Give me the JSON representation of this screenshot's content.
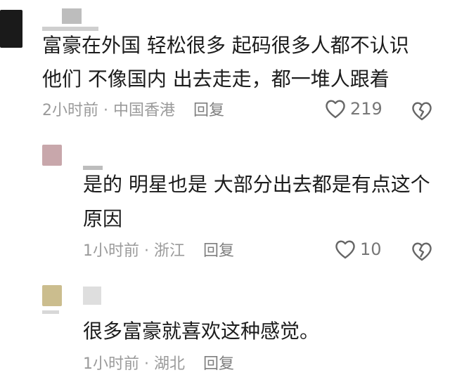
{
  "comments": [
    {
      "text_lines": [
        "富豪在外国 轻松很多 起码很多人都不认识",
        "他们 不像国内 出去走走，都一堆人跟着"
      ],
      "time": "2小时前",
      "location": "中国香港",
      "reply_label": "回复",
      "likes": "219",
      "avatar_color": "#1a1a1a"
    },
    {
      "text_lines": [
        "是的 明星也是 大部分出去都是有点这个",
        "原因"
      ],
      "time": "1小时前",
      "location": "浙江",
      "reply_label": "回复",
      "likes": "10",
      "avatar_color": "#c8a7ab"
    },
    {
      "text_lines": [
        "很多富豪就喜欢这种感觉。"
      ],
      "time": "1小时前",
      "location": "湖北",
      "reply_label": "回复",
      "avatar_color": "#cbbd8e"
    }
  ],
  "separator": " · ",
  "icons": {
    "like": "heart-outline-icon",
    "dislike": "broken-heart-icon"
  }
}
